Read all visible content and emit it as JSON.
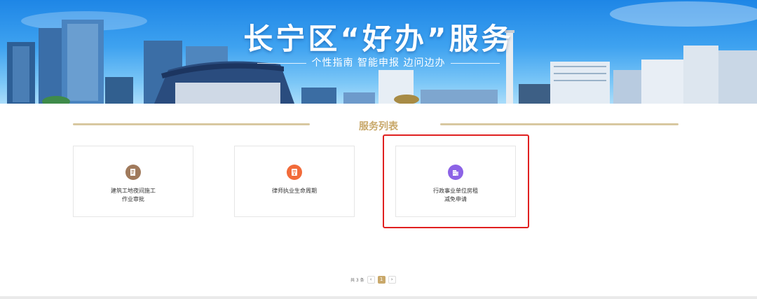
{
  "banner": {
    "title": "长宁区“好办”服务",
    "subtitle": "个性指南  智能申报  边问边办"
  },
  "section": {
    "title": "服务列表"
  },
  "services": [
    {
      "label": "建筑工地夜间施工\n作业审批",
      "icon": "document-icon",
      "color": "#a07a5c"
    },
    {
      "label": "律师执业生命周期",
      "icon": "id-card-icon",
      "color": "#f26b3a"
    },
    {
      "label": "行政事业单位房租\n减免申请",
      "icon": "building-icon",
      "color": "#8c63e6"
    }
  ],
  "pagination": {
    "total": "共 3 条",
    "prev": "‹",
    "current": "1",
    "next": "›"
  },
  "colors": {
    "accent": "#c9a86a",
    "highlight": "#e02020"
  }
}
